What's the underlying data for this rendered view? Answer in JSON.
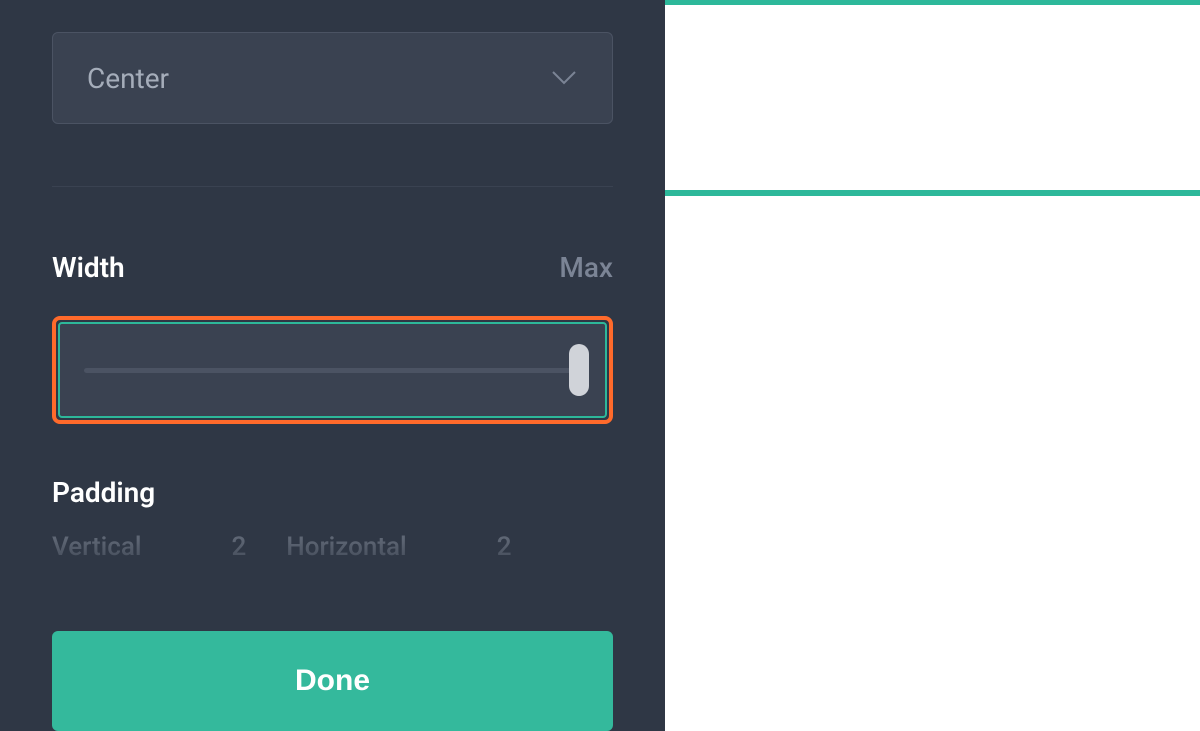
{
  "alignment": {
    "selected": "Center"
  },
  "width": {
    "label": "Width",
    "value": "Max"
  },
  "padding": {
    "label": "Padding",
    "vertical": {
      "label": "Vertical",
      "value": "2"
    },
    "horizontal": {
      "label": "Horizontal",
      "value": "2"
    }
  },
  "footer": {
    "done": "Done"
  }
}
